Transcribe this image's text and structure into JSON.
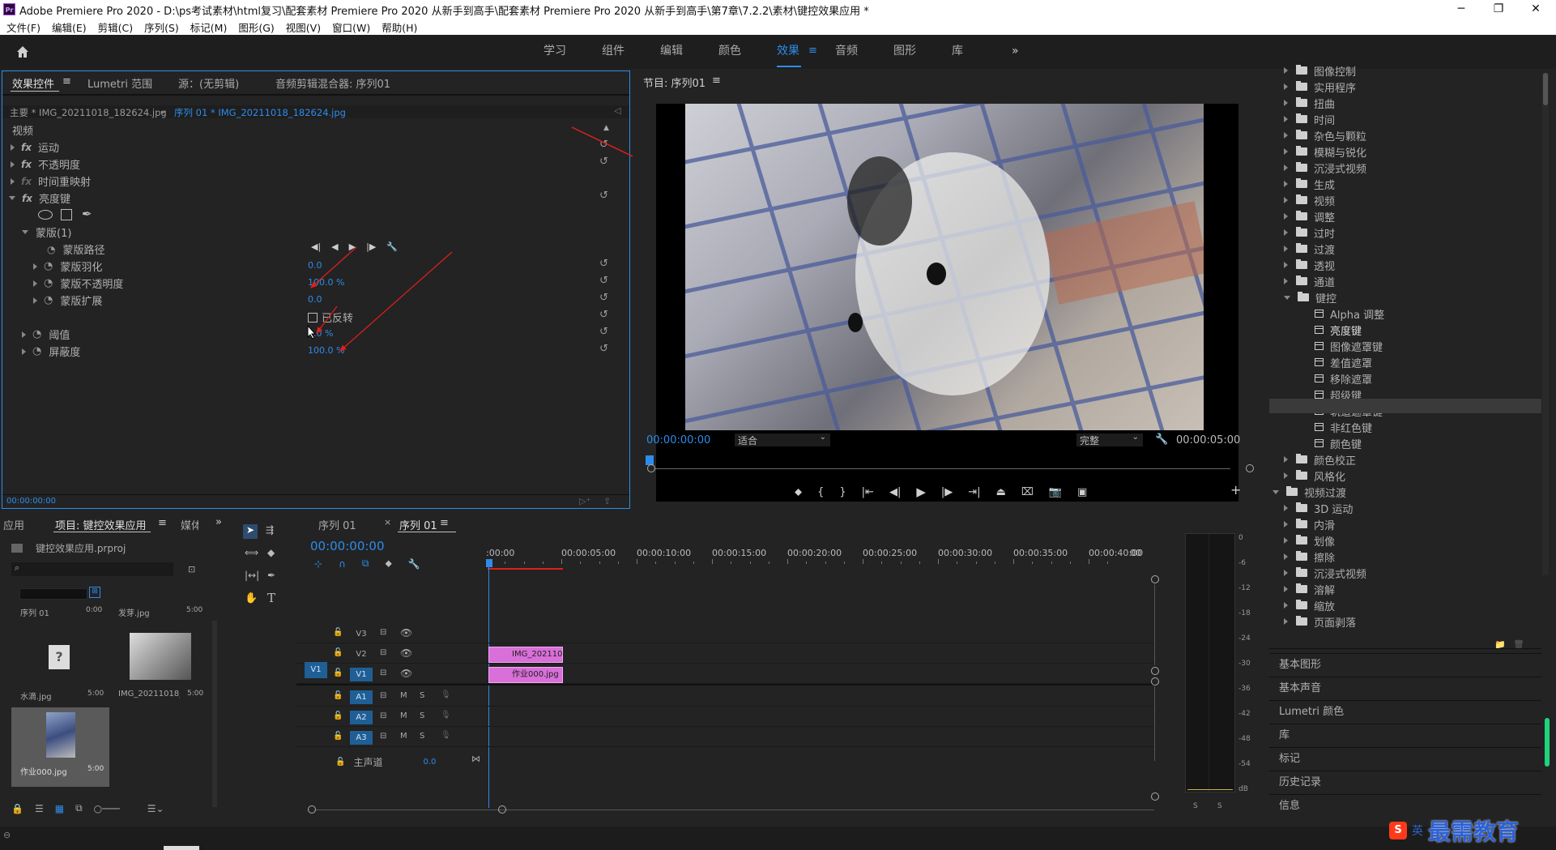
{
  "window": {
    "title": "Adobe Premiere Pro 2020 - D:\\ps考试素材\\html复习\\配套素材 Premiere Pro 2020 从新手到高手\\配套素材 Premiere Pro 2020 从新手到高手\\第7章\\7.2.2\\素材\\键控效果应用 *",
    "app_badge": "Pr",
    "controls": [
      "─",
      "❐",
      "✕"
    ]
  },
  "menu": [
    "文件(F)",
    "编辑(E)",
    "剪辑(C)",
    "序列(S)",
    "标记(M)",
    "图形(G)",
    "视图(V)",
    "窗口(W)",
    "帮助(H)"
  ],
  "workspace": {
    "tabs": [
      "学习",
      "组件",
      "编辑",
      "颜色",
      "效果",
      "音频",
      "图形",
      "库"
    ],
    "active": "效果",
    "more": "»"
  },
  "effect_controls": {
    "tabs": [
      "效果控件",
      "Lumetri 范围",
      "源：(无剪辑)",
      "音频剪辑混合器: 序列01"
    ],
    "master": "主要 * IMG_20211018_182624.jpg",
    "sequence_clip": "序列 01 * IMG_20211018_182624.jpg",
    "section": "视频",
    "rows": {
      "motion": "运动",
      "opacity": "不透明度",
      "time_remap": "时间重映射",
      "luma_key": "亮度键",
      "mask": "蒙版(1)",
      "mask_path": "蒙版路径",
      "mask_feather": "蒙版羽化",
      "mask_feather_val": "0.0",
      "mask_opacity": "蒙版不透明度",
      "mask_opacity_val": "100.0 %",
      "mask_expand": "蒙版扩展",
      "mask_expand_val": "0.0",
      "inverted": "已反转",
      "threshold": "阈值",
      "threshold_val": "0.0 %",
      "cutoff": "屏蔽度",
      "cutoff_val": "100.0 %"
    },
    "timecode": "00:00:00:00"
  },
  "program": {
    "title": "节目: 序列01",
    "timecode": "00:00:00:00",
    "fit": "适合",
    "quality": "完整",
    "duration": "00:00:05:00"
  },
  "effects_tree": {
    "items": [
      "图像控制",
      "实用程序",
      "扭曲",
      "时间",
      "杂色与颗粒",
      "模糊与锐化",
      "沉浸式视频",
      "生成",
      "视频",
      "调整",
      "过时",
      "过渡",
      "透视",
      "通道",
      "键控"
    ],
    "keying_children": [
      "Alpha 调整",
      "亮度键",
      "图像遮罩键",
      "差值遮罩",
      "移除遮罩",
      "超级键",
      "轨道遮罩键",
      "非红色键",
      "颜色键"
    ],
    "after": [
      "颜色校正",
      "风格化"
    ],
    "transitions_folder": "视频过渡",
    "transition_children": [
      "3D 运动",
      "内滑",
      "划像",
      "擦除",
      "沉浸式视频",
      "溶解",
      "缩放",
      "页面剥落"
    ],
    "selected": "亮度键"
  },
  "side_panels": [
    "基本图形",
    "基本声音",
    "Lumetri 颜色",
    "库",
    "标记",
    "历史记录",
    "信息"
  ],
  "project": {
    "tabs": [
      "应用",
      "项目: 键控效果应用",
      "媒体"
    ],
    "file": "键控效果应用.prproj",
    "items": [
      {
        "name": "序列 01",
        "dur": "0:00"
      },
      {
        "name": "发芽.jpg",
        "dur": "5:00"
      },
      {
        "name": "水滴.jpg",
        "dur": "5:00"
      },
      {
        "name": "IMG_20211018_...",
        "dur": "5:00"
      },
      {
        "name": "作业000.jpg",
        "dur": "5:00"
      }
    ]
  },
  "timeline": {
    "tabs": [
      "序列 01",
      "序列 01"
    ],
    "timecode": "00:00:00:00",
    "ruler": [
      ":00:00",
      "00:00:05:00",
      "00:00:10:00",
      "00:00:15:00",
      "00:00:20:00",
      "00:00:25:00",
      "00:00:30:00",
      "00:00:35:00",
      "00:00:40:00",
      "00"
    ],
    "video_tracks": [
      "V3",
      "V2",
      "V1"
    ],
    "audio_tracks": [
      "A1",
      "A2",
      "A3"
    ],
    "master": "主声道",
    "master_val": "0.0",
    "clips": {
      "v2": "IMG_202110",
      "v1": "作业000.jpg"
    },
    "source_patch": "V1"
  },
  "meter": {
    "scale": [
      "0",
      "-6",
      "-12",
      "-18",
      "-24",
      "-30",
      "-36",
      "-42",
      "-48",
      "-54",
      "dB"
    ],
    "solo": [
      "S",
      "S"
    ]
  },
  "watermark": {
    "ime": "英",
    "brand": "最需教育",
    "ime_mark": "S"
  },
  "colors": {
    "accent": "#2d8ceb",
    "clip": "#d96fd9",
    "panel": "#232323",
    "arrow": "#e0201a"
  }
}
